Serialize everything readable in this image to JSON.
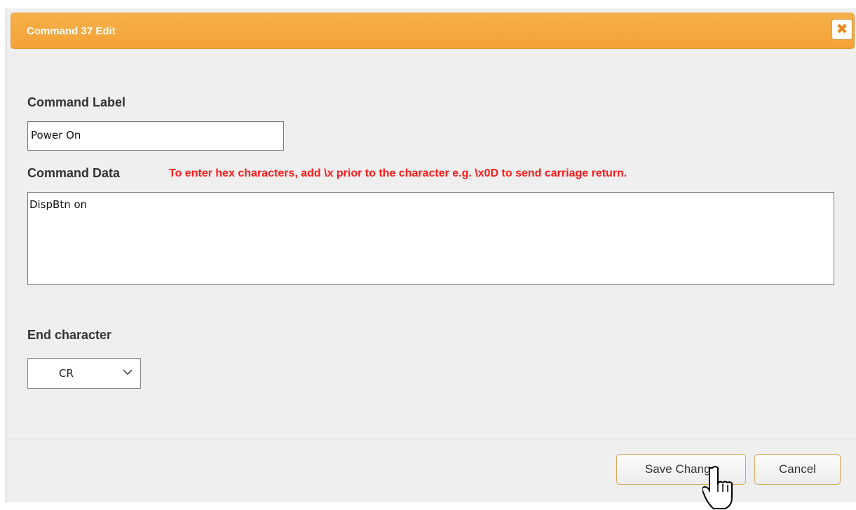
{
  "dialog": {
    "title": "Command 37 Edit",
    "close_icon": "close-icon"
  },
  "form": {
    "command_label": {
      "label": "Command Label",
      "value": "Power On"
    },
    "command_data": {
      "label": "Command Data",
      "hint": "To enter hex characters, add \\x prior to the character e.g. \\x0D to send carriage return.",
      "value": "DispBtn on"
    },
    "end_character": {
      "label": "End character",
      "selected": "CR"
    }
  },
  "buttons": {
    "save": "Save Change",
    "cancel": "Cancel"
  },
  "colors": {
    "titlebar": "#f3a236",
    "hint_text": "#ff1a1a",
    "button_border": "#d5a75a",
    "dialog_bg": "#efefef"
  }
}
